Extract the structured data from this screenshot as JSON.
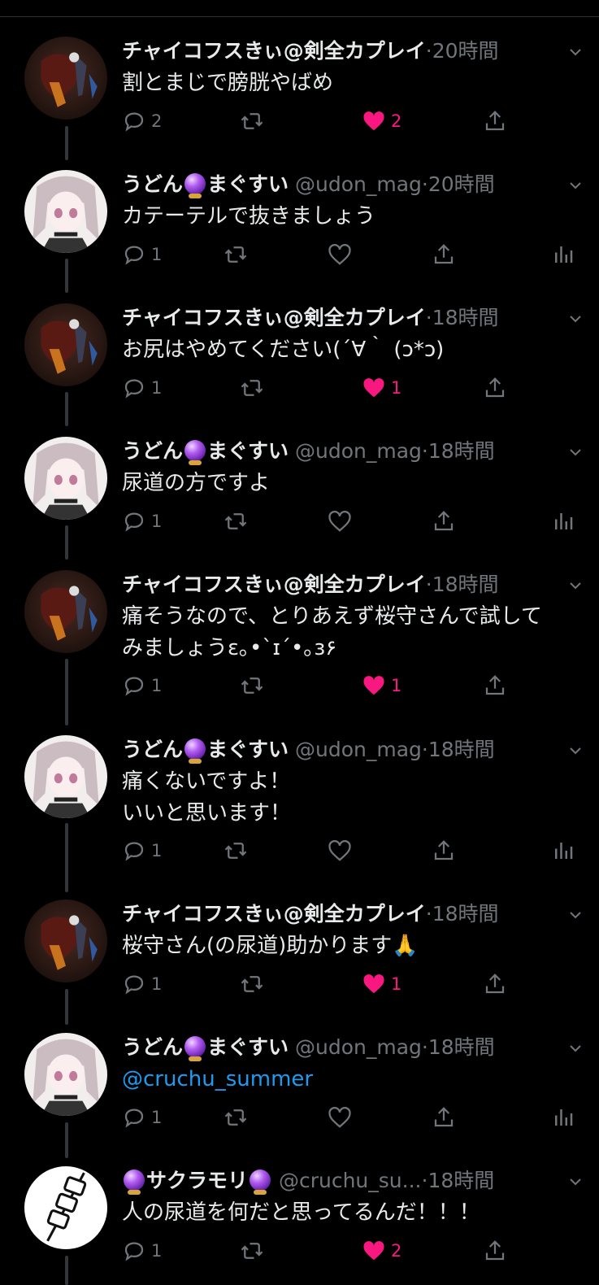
{
  "tweets": [
    {
      "name": "チャイコフスきぃ@剣全カプレイ",
      "handle": "",
      "time": "20時間",
      "text": "割とまじで膀胱やばめ",
      "reply": "2",
      "retweet": "",
      "like": "2",
      "liked": true,
      "analytics": false,
      "avatar": "dark"
    },
    {
      "name_pre": "うどん",
      "name_post": "まぐすい",
      "handle": "@udon_mag",
      "time": "20時間",
      "text": "カテーテルで抜きましょう",
      "reply": "1",
      "retweet": "",
      "like": "",
      "liked": false,
      "analytics": true,
      "avatar": "girl"
    },
    {
      "name": "チャイコフスきぃ@剣全カプレイ",
      "handle": "",
      "time": "18時間",
      "text": "お尻はやめてください(´∀｀ (ↄ*ↄ)",
      "reply": "1",
      "retweet": "",
      "like": "1",
      "liked": true,
      "analytics": false,
      "avatar": "dark"
    },
    {
      "name_pre": "うどん",
      "name_post": "まぐすい",
      "handle": "@udon_mag",
      "time": "18時間",
      "text": "尿道の方ですよ",
      "reply": "1",
      "retweet": "",
      "like": "",
      "liked": false,
      "analytics": true,
      "avatar": "girl"
    },
    {
      "name": "チャイコフスきぃ@剣全カプレイ",
      "handle": "",
      "time": "18時間",
      "text": "痛そうなので、とりあえず桜守さんで試して\nみましょうɛ｡•`ɪ´•｡ɜ۶",
      "reply": "1",
      "retweet": "",
      "like": "1",
      "liked": true,
      "analytics": false,
      "avatar": "dark"
    },
    {
      "name_pre": "うどん",
      "name_post": "まぐすい",
      "handle": "@udon_mag",
      "time": "18時間",
      "text": "痛くないですよ！\nいいと思います！",
      "reply": "1",
      "retweet": "",
      "like": "",
      "liked": false,
      "analytics": true,
      "avatar": "girl"
    },
    {
      "name": "チャイコフスきぃ@剣全カプレイ",
      "handle": "",
      "time": "18時間",
      "text": "桜守さん(の尿道)助かります",
      "emoji": "🙏",
      "reply": "1",
      "retweet": "",
      "like": "1",
      "liked": true,
      "analytics": false,
      "avatar": "dark"
    },
    {
      "name_pre": "うどん",
      "name_post": "まぐすい",
      "handle": "@udon_mag",
      "time": "18時間",
      "mention": "@cruchu_summer",
      "reply": "1",
      "retweet": "",
      "like": "",
      "liked": false,
      "analytics": true,
      "avatar": "girl"
    },
    {
      "name_mid": "サクラモリ",
      "handle": "@cruchu_su...",
      "time": "18時間",
      "text": "人の尿道を何だと思ってるんだ！！！",
      "reply": "1",
      "retweet": "",
      "like": "2",
      "liked": true,
      "analytics": false,
      "avatar": "skewer"
    }
  ],
  "separator": "·",
  "colors": {
    "like": "#f91880",
    "link": "#1d9bf0",
    "muted": "#71767b"
  }
}
